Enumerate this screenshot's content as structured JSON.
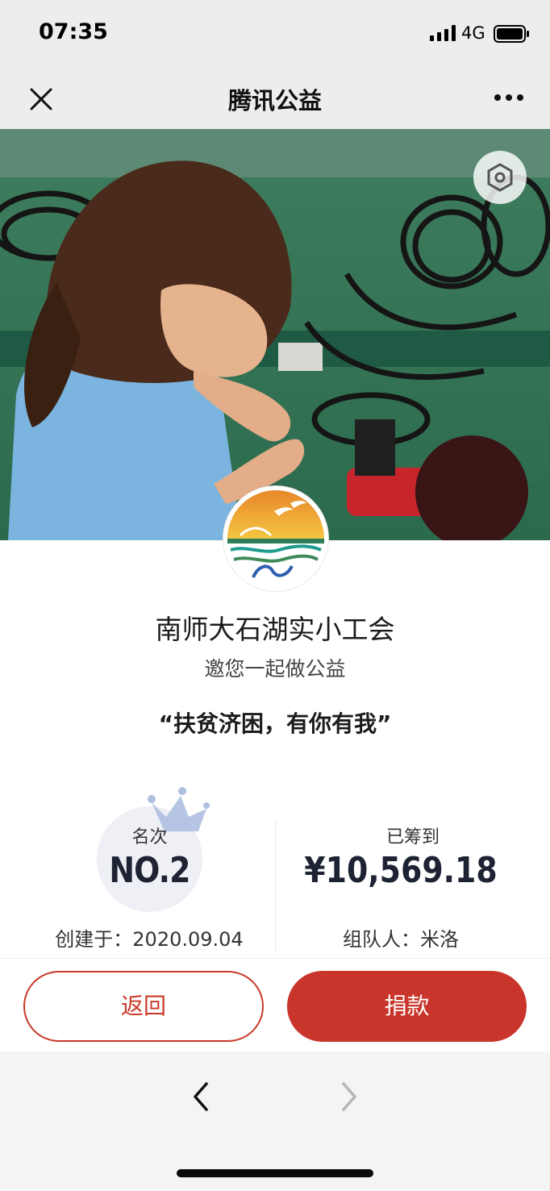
{
  "status_bar": {
    "time": "07:35",
    "network": "4G"
  },
  "nav": {
    "title": "腾讯公益"
  },
  "org": {
    "name": "南师大石湖实小工会",
    "invite": "邀您一起做公益",
    "slogan": "“扶贫济困，有你有我”"
  },
  "stats": {
    "rank_label": "名次",
    "rank_value": "NO.2",
    "created": "创建于：2020.09.04",
    "raised_label": "已筹到",
    "raised_value": "¥10,569.18",
    "team_leader": "组队人：米洛"
  },
  "actions": {
    "back_label": "返回",
    "donate_label": "捐款"
  },
  "colors": {
    "accent": "#c9352a",
    "nav_bg": "#ededed",
    "rank_circle": "#eef0f6",
    "crown": "#aebfe0"
  },
  "icons": [
    "close-icon",
    "more-icon",
    "settings-icon",
    "crown-icon",
    "chevron-left-icon",
    "chevron-right-icon"
  ]
}
